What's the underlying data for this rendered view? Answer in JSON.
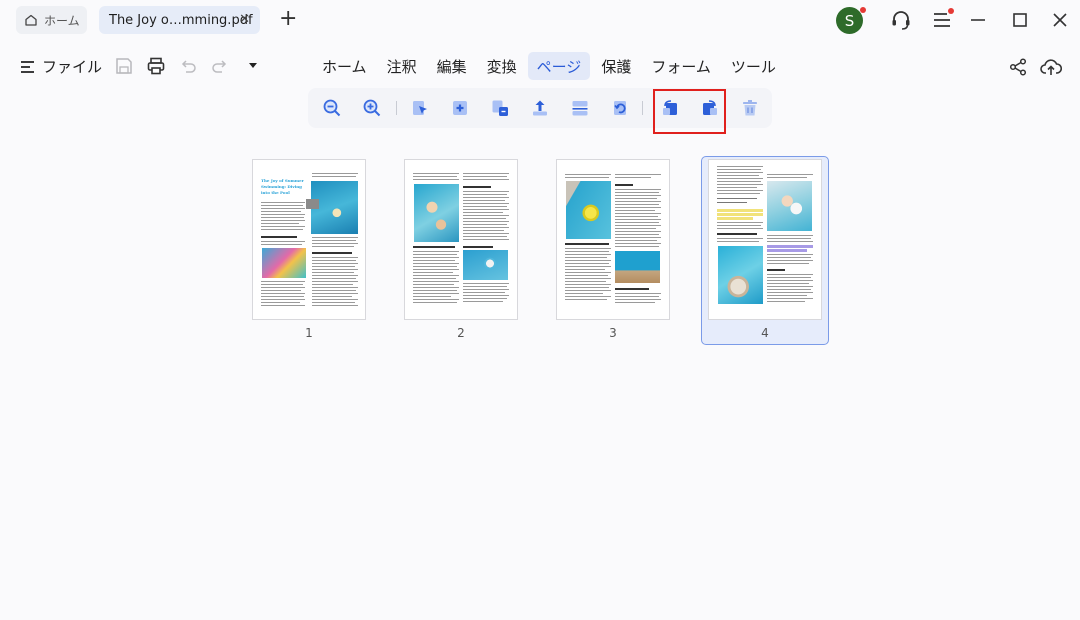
{
  "tabs": {
    "home_label": "ホーム",
    "doc_label": "The Joy o…mming.pdf",
    "close_glyph": "✕",
    "new_tab_glyph": "+"
  },
  "user": {
    "avatar_letter": "S"
  },
  "menubar": {
    "file_label": "ファイル",
    "tabs": [
      {
        "label": "ホーム",
        "active": false
      },
      {
        "label": "注釈",
        "active": false
      },
      {
        "label": "編集",
        "active": false
      },
      {
        "label": "変換",
        "active": false
      },
      {
        "label": "ページ",
        "active": true
      },
      {
        "label": "保護",
        "active": false
      },
      {
        "label": "フォーム",
        "active": false
      },
      {
        "label": "ツール",
        "active": false
      }
    ]
  },
  "page_toolbar": {
    "tools": [
      "zoom-out-icon",
      "zoom-in-icon",
      "extract-icon",
      "insert-icon",
      "replace-icon",
      "export-icon",
      "split-icon",
      "rotate-icon",
      "rotate-left-icon",
      "rotate-right-icon",
      "delete-icon"
    ],
    "highlighted": [
      "rotate-left-icon",
      "rotate-right-icon"
    ]
  },
  "thumbnails": {
    "pages": [
      {
        "number": "1",
        "selected": false,
        "title": "The Joy of Summer Swimming: Diving into the Pool"
      },
      {
        "number": "2",
        "selected": false
      },
      {
        "number": "3",
        "selected": false
      },
      {
        "number": "4",
        "selected": true
      }
    ]
  },
  "colors": {
    "accent": "#2a5bd7",
    "highlight_box": "#e0201d",
    "avatar_bg": "#2e6b2a",
    "notification_dot": "#e53935"
  }
}
